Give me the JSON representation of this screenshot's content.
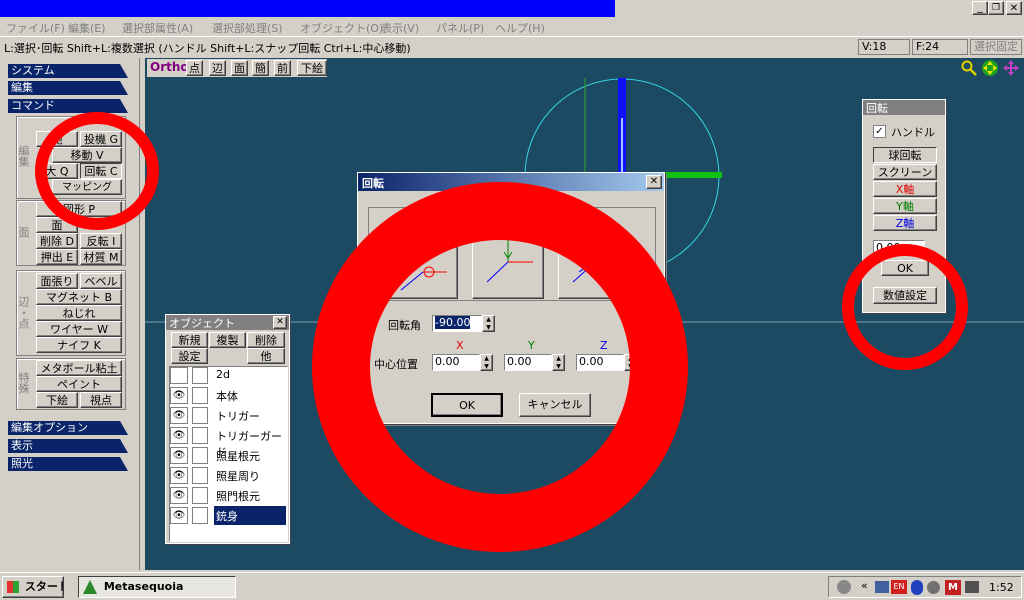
{
  "menubar": {
    "items": [
      "ファイル(F)",
      "編集(E)",
      "選択部属性(A)",
      "選択部処理(S)",
      "オブジェクト(O)",
      "表示(V)",
      "パネル(P)",
      "ヘルプ(H)"
    ]
  },
  "statusbar": {
    "hint": "L:選択･回転  Shift+L:複数選択  (ハンドル  Shift+L:スナップ回転  Ctrl+L:中心移動)",
    "vertices": "V:18",
    "faces": "F:24",
    "lock": "選択固定"
  },
  "side": {
    "categories": [
      "システム",
      "編集",
      "コマンド",
      "編集オプション",
      "表示",
      "照光"
    ],
    "group_labels": {
      "edit": "編集",
      "face": "面",
      "edge": "辺・点",
      "special": "特殊"
    },
    "commands": {
      "move_v": "移動 V",
      "proj": "投機 G",
      "rot_c": "回転 C",
      "size_q": "大 Q",
      "mapping": "マッピング",
      "shape_p": "図形 P",
      "face": "面",
      "delete_d": "削除 D",
      "flip_i": "反転 I",
      "push_e": "押出 E",
      "material_m": "材質 M",
      "face_fill": "面張り",
      "bevel": "ベベル",
      "magnet_b": "マグネット B",
      "twist": "ねじれ",
      "wire_w": "ワイヤー W",
      "knife_k": "ナイフ K",
      "metaball": "メタボール粘土",
      "paint": "ペイント",
      "underlay": "下絵",
      "viewpoint": "視点"
    }
  },
  "viewport": {
    "mode": "Ortho",
    "tabs": [
      "点",
      "辺",
      "面",
      "簡",
      "前",
      "下絵"
    ]
  },
  "object_panel": {
    "title": "オブジェクト",
    "buttons": {
      "new": "新規",
      "dup": "複製",
      "del": "削除",
      "settings": "設定",
      "other": "他"
    },
    "items": [
      "2d",
      "本体",
      "トリガー",
      "トリガーガード",
      "照星根元",
      "照星周り",
      "照門根元",
      "銃身"
    ],
    "selected_index": 7
  },
  "rotate_dialog": {
    "title": "回転",
    "angle_label": "回転角",
    "angle_value": "-90.00",
    "center_label": "中心位置",
    "axis_x": "X",
    "axis_y": "Y",
    "axis_z": "Z",
    "x_value": "0.00",
    "y_value": "0.00",
    "z_value": "0.00",
    "ok": "OK",
    "cancel": "キャンセル"
  },
  "rotate_panel": {
    "title": "回転",
    "handle_label": "ハンドル",
    "handle_checked": true,
    "sphere": "球回転",
    "screen": "スクリーン",
    "x_axis": "X軸",
    "y_axis": "Y軸",
    "z_axis": "Z軸",
    "value": "0.00",
    "ok": "OK",
    "numeric": "数値設定"
  },
  "taskbar": {
    "start": "スタート",
    "app": "Metasequoia",
    "clock": "1:52"
  },
  "colors": {
    "title_blue": "#0000ff",
    "viewport_bg": "#1c4a62",
    "selection_navy": "#0a246a",
    "annotation_red": "#ff0000"
  }
}
